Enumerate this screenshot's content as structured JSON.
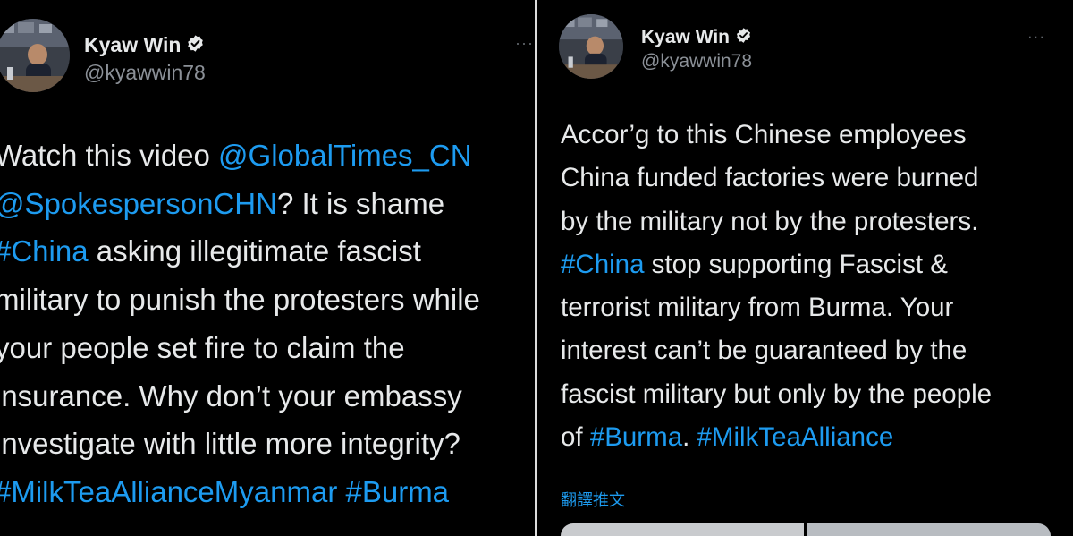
{
  "left_tweet": {
    "author_name": "Kyaw Win",
    "handle": "@kyawwin78",
    "more_glyph": "···",
    "lines": [
      [
        {
          "t": "Watch this video "
        },
        {
          "t": "@GlobalTimes_CN",
          "link": true
        }
      ],
      [
        {
          "t": "@SpokespersonCHN",
          "link": true
        },
        {
          "t": "? It is shame"
        }
      ],
      [
        {
          "t": "#China",
          "link": true
        },
        {
          "t": " asking illegitimate fascist"
        }
      ],
      [
        {
          "t": "military to punish the protesters while"
        }
      ],
      [
        {
          "t": "your people set fire to claim the"
        }
      ],
      [
        {
          "t": "insurance. Why don’t your embassy"
        }
      ],
      [
        {
          "t": "investigate with little more integrity?"
        }
      ],
      [
        {
          "t": "#MilkTeaAllianceMyanmar",
          "link": true
        },
        {
          "t": " "
        },
        {
          "t": "#Burma",
          "link": true
        }
      ]
    ]
  },
  "right_tweet": {
    "author_name": "Kyaw Win",
    "handle": "@kyawwin78",
    "more_glyph": "···",
    "lines": [
      [
        {
          "t": "Accor’g to this Chinese employees"
        }
      ],
      [
        {
          "t": "China funded factories were burned"
        }
      ],
      [
        {
          "t": "by the military not by the protesters."
        }
      ],
      [
        {
          "t": "#China",
          "link": true
        },
        {
          "t": " stop supporting Fascist &"
        }
      ],
      [
        {
          "t": "terrorist military from Burma. Your"
        }
      ],
      [
        {
          "t": "interest can’t be guaranteed by the"
        }
      ],
      [
        {
          "t": "fascist military but only by the people"
        }
      ],
      [
        {
          "t": "of "
        },
        {
          "t": "#Burma",
          "link": true
        },
        {
          "t": ". "
        },
        {
          "t": "#MilkTeaAlliance",
          "link": true
        }
      ]
    ],
    "translate_label": "翻譯推文"
  },
  "colors": {
    "background": "#000000",
    "text": "#e7e9ea",
    "link": "#1d9bf0",
    "secondary": "#8b9097",
    "verified_badge": "#e7e9ea"
  },
  "icons": {
    "verified": "verified-badge-icon",
    "more": "more-options-icon"
  }
}
